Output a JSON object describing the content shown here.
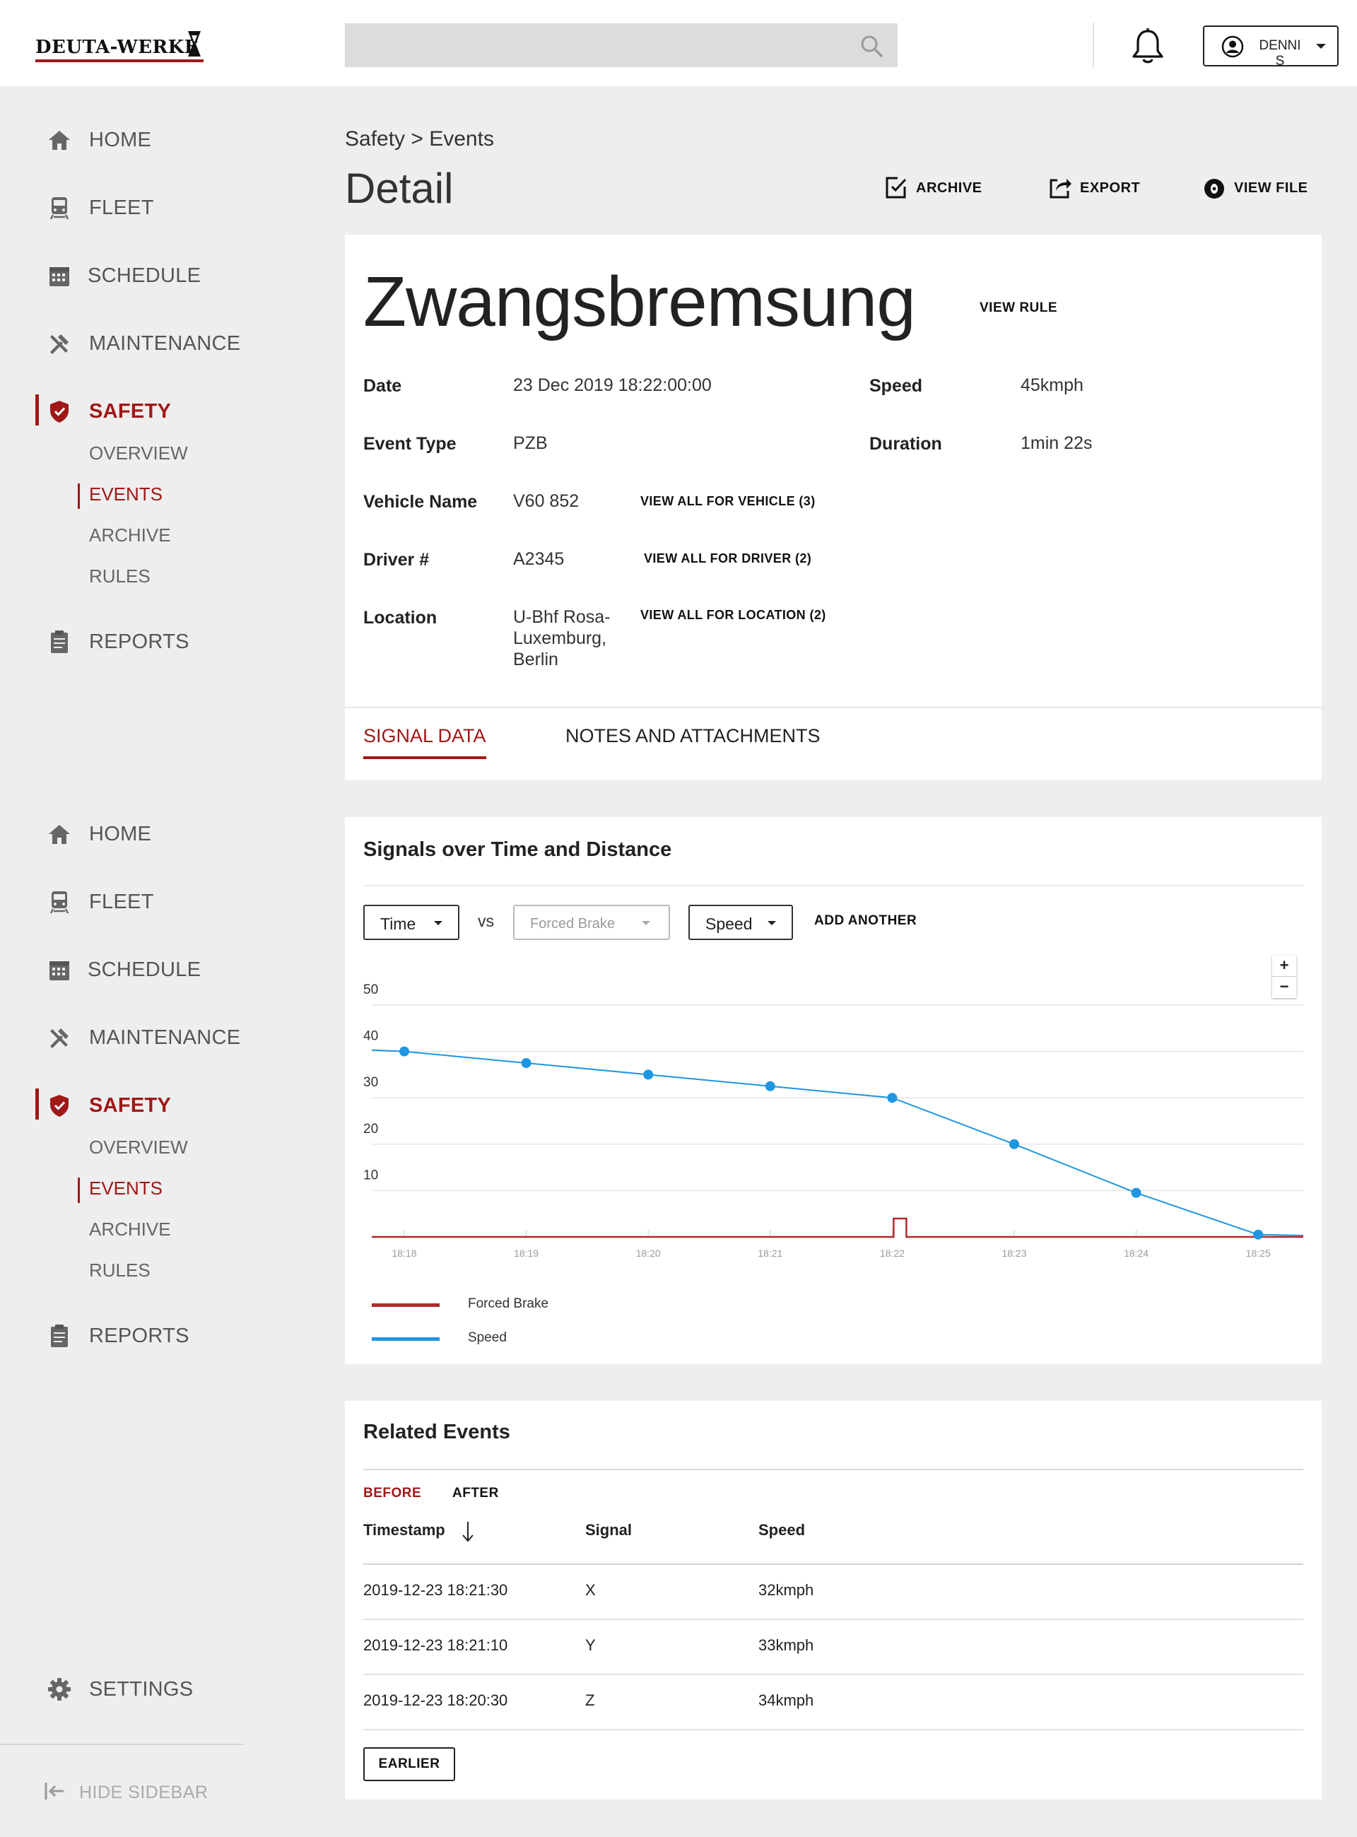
{
  "header": {
    "logo_text": "DEUTA-WERKE",
    "search_placeholder": "",
    "user_name": "DENNIS"
  },
  "sidebar": {
    "items": [
      {
        "label": "HOME",
        "icon": "home-icon"
      },
      {
        "label": "FLEET",
        "icon": "train-icon"
      },
      {
        "label": "SCHEDULE",
        "icon": "calendar-icon"
      },
      {
        "label": "MAINTENANCE",
        "icon": "tools-icon"
      },
      {
        "label": "SAFETY",
        "icon": "shield-icon",
        "active": true
      },
      {
        "label": "REPORTS",
        "icon": "clipboard-icon"
      }
    ],
    "safety_sub": [
      "OVERVIEW",
      "EVENTS",
      "ARCHIVE",
      "RULES"
    ],
    "active_sub": "EVENTS",
    "settings_label": "SETTINGS",
    "hide_label": "HIDE SIDEBAR"
  },
  "page": {
    "breadcrumb": "Safety > Events",
    "title": "Detail",
    "actions": {
      "archive": "ARCHIVE",
      "export": "EXPORT",
      "view_file": "VIEW FILE"
    }
  },
  "event": {
    "name": "Zwangsbremsung",
    "view_rule": "VIEW RULE",
    "fields": {
      "date_label": "Date",
      "date_value": "23 Dec 2019 18:22:00:00",
      "type_label": "Event Type",
      "type_value": "PZB",
      "vehicle_label": "Vehicle Name",
      "vehicle_value": "V60 852",
      "driver_label": "Driver #",
      "driver_value": "A2345",
      "location_label": "Location",
      "location_value": "U-Bhf Rosa-Luxemburg, Berlin",
      "speed_label": "Speed",
      "speed_value": "45kmph",
      "duration_label": "Duration",
      "duration_value": "1min 22s"
    },
    "links": {
      "vehicle": "VIEW ALL FOR VEHICLE (3)",
      "driver": "VIEW ALL FOR DRIVER (2)",
      "location": "VIEW ALL FOR LOCATION (2)"
    },
    "tabs": [
      "SIGNAL DATA",
      "NOTES AND ATTACHMENTS"
    ]
  },
  "signals": {
    "title": "Signals over Time and Distance",
    "select_x": "Time",
    "vs_label": "vs",
    "select_signal": "Forced Brake",
    "select_y": "Speed",
    "add_another": "ADD ANOTHER",
    "zoom_in": "+",
    "zoom_out": "−"
  },
  "chart_data": {
    "type": "line",
    "x": [
      "18:18",
      "18:19",
      "18:20",
      "18:21",
      "18:22",
      "18:23",
      "18:24",
      "18:25"
    ],
    "series": [
      {
        "name": "Speed",
        "values": [
          40,
          37.5,
          35,
          32.5,
          30,
          20,
          9.5,
          0.5
        ],
        "color": "#1e96e0"
      },
      {
        "name": "Forced Brake",
        "values": [
          0,
          0,
          0,
          0,
          1,
          0,
          0,
          0
        ],
        "color": "#b02a2a"
      }
    ],
    "yticks": [
      10,
      20,
      30,
      40,
      50
    ],
    "ylim": [
      0,
      50
    ],
    "grid": true,
    "legend": "bottom-left"
  },
  "related": {
    "title": "Related Events",
    "tabs": [
      "BEFORE",
      "AFTER"
    ],
    "active_tab": "BEFORE",
    "columns": [
      "Timestamp",
      "Signal",
      "Speed"
    ],
    "rows": [
      [
        "2019-12-23 18:21:30",
        "X",
        "32kmph"
      ],
      [
        "2019-12-23 18:21:10",
        "Y",
        "33kmph"
      ],
      [
        "2019-12-23 18:20:30",
        "Z",
        "34kmph"
      ]
    ],
    "earlier": "EARLIER"
  },
  "colors": {
    "accent": "#a01818",
    "speed": "#1e96e0",
    "brake": "#b02a2a"
  }
}
